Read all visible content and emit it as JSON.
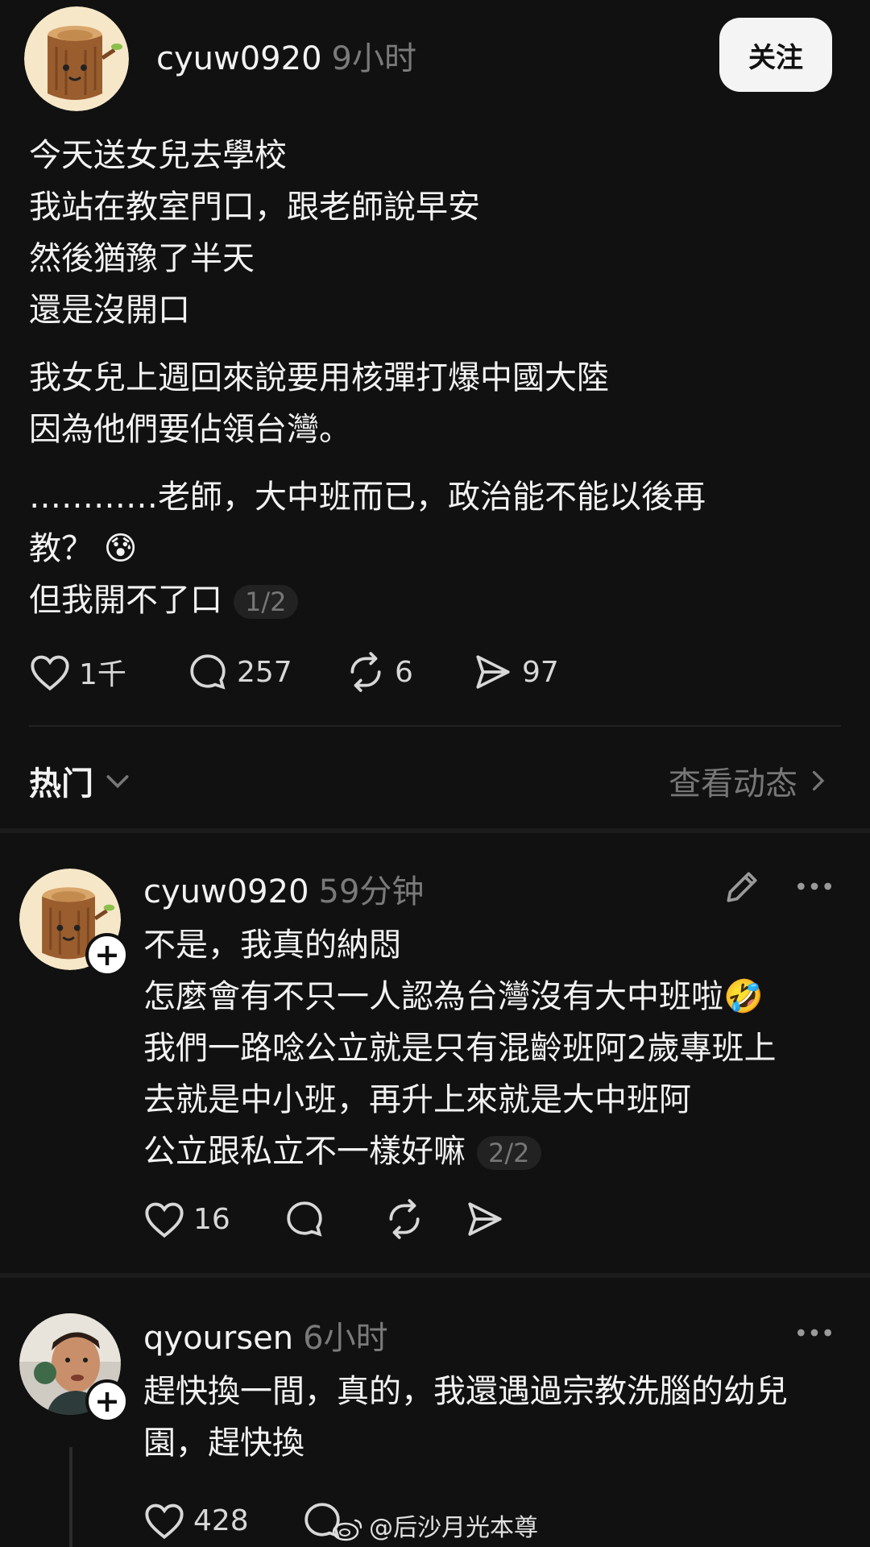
{
  "post": {
    "author": "cyuw0920",
    "time": "9小时",
    "follow_label": "关注",
    "lines": [
      "今天送女兒去學校",
      "我站在教室門口，跟老師說早安",
      "然後猶豫了半天",
      "還是沒開口",
      "我女兒上週回來說要用核彈打爆中國大陸",
      "因為他們要佔領台灣。",
      "…………老師，大中班而已，政治能不能以後再",
      "教？ 😰",
      "但我開不了口"
    ],
    "pager": "1/2",
    "likes": "1千",
    "comments": "257",
    "reposts": "6",
    "shares": "97"
  },
  "sort": {
    "label": "热门",
    "view_activity": "查看动态"
  },
  "replies": [
    {
      "author": "cyuw0920",
      "time": "59分钟",
      "lines": [
        "不是，我真的納悶",
        "怎麼會有不只一人認為台灣沒有大中班啦🤣",
        "我們一路唸公立就是只有混齡班阿2歲專班上",
        "去就是中小班，再升上來就是大中班阿",
        "公立跟私立不一樣好嘛"
      ],
      "pager": "2/2",
      "likes": "16"
    },
    {
      "author": "qyoursen",
      "time": "6小时",
      "lines": [
        "趕快換一間，真的，我還遇過宗教洗腦的幼兒",
        "園，趕快換"
      ],
      "likes": "428"
    }
  ],
  "watermark": "@后沙月光本尊",
  "colors": {
    "background": "#111111",
    "text": "#f2f2f2",
    "muted": "#7a7a7a",
    "button_bg": "#f4f4f4"
  }
}
